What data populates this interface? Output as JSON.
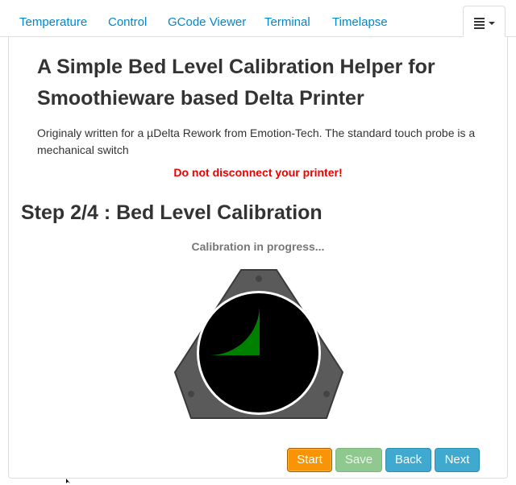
{
  "tabs": [
    {
      "label": "Temperature"
    },
    {
      "label": "Control"
    },
    {
      "label": "GCode Viewer"
    },
    {
      "label": "Terminal"
    },
    {
      "label": "Timelapse"
    }
  ],
  "content": {
    "title": "A Simple Bed Level Calibration Helper for Smoothieware based Delta Printer",
    "description": "Originaly written for a µDelta Rework from Emotion-Tech. The standard touch probe is a mechanical switch",
    "warning": "Do not disconnect your printer!",
    "step_heading": "Step 2/4 : Bed Level Calibration",
    "status": "Calibration in progress...",
    "progress_fraction": 0.25
  },
  "buttons": {
    "start": "Start",
    "save": "Save",
    "back": "Back",
    "next": "Next"
  },
  "colors": {
    "link": "#0088cc",
    "warning": "#ee0000",
    "start": "#f89406",
    "save": "#8fc98f",
    "info": "#3fa9cf",
    "progress_fill": "#008000"
  }
}
